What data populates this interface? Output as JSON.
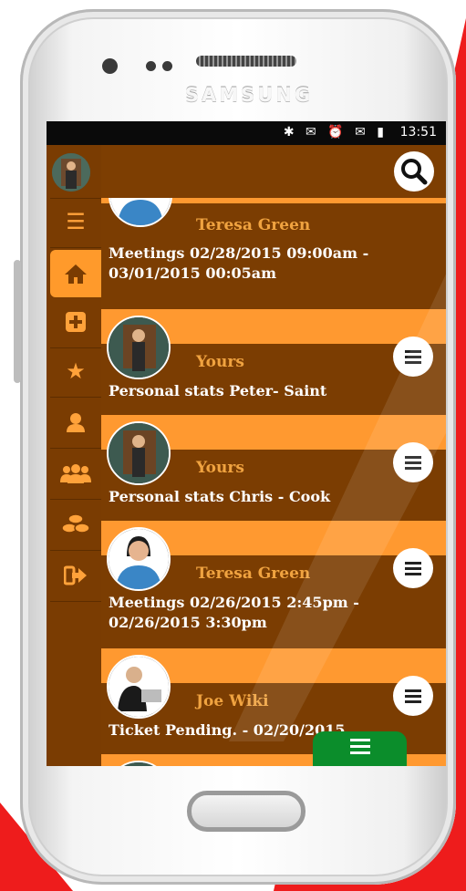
{
  "device": {
    "brand": "SAMSUNG"
  },
  "status_bar": {
    "icons": "✱ ✉ ⏰ ✉ ▮",
    "time": "13:51"
  },
  "colors": {
    "accent": "#ff9930",
    "dark": "#7b3d02",
    "fab": "#0b8d2b"
  },
  "sidebar": {
    "items": [
      {
        "icon": "menu-icon",
        "glyph": "☰"
      },
      {
        "icon": "home-icon",
        "glyph": "⌂"
      },
      {
        "icon": "plus-icon",
        "glyph": "✚"
      },
      {
        "icon": "star-icon",
        "glyph": "★"
      },
      {
        "icon": "user-icon",
        "glyph": "●"
      },
      {
        "icon": "group-icon",
        "glyph": "●●"
      },
      {
        "icon": "coins-icon",
        "glyph": "◎"
      },
      {
        "icon": "logout-icon",
        "glyph": "➜"
      }
    ]
  },
  "feed": {
    "items": [
      {
        "owner": "Teresa Green",
        "title": "Meetings 02/28/2015 09:00am - 03/01/2015 00:05am"
      },
      {
        "owner": "Yours",
        "title": "Personal stats Peter- Saint"
      },
      {
        "owner": "Yours",
        "title": "Personal stats Chris - Cook"
      },
      {
        "owner": "Teresa Green",
        "title": "Meetings 02/26/2015 2:45pm - 02/26/2015 3:30pm"
      },
      {
        "owner": "Joe Wiki",
        "title": "Ticket Pending. - 02/20/2015"
      }
    ]
  }
}
